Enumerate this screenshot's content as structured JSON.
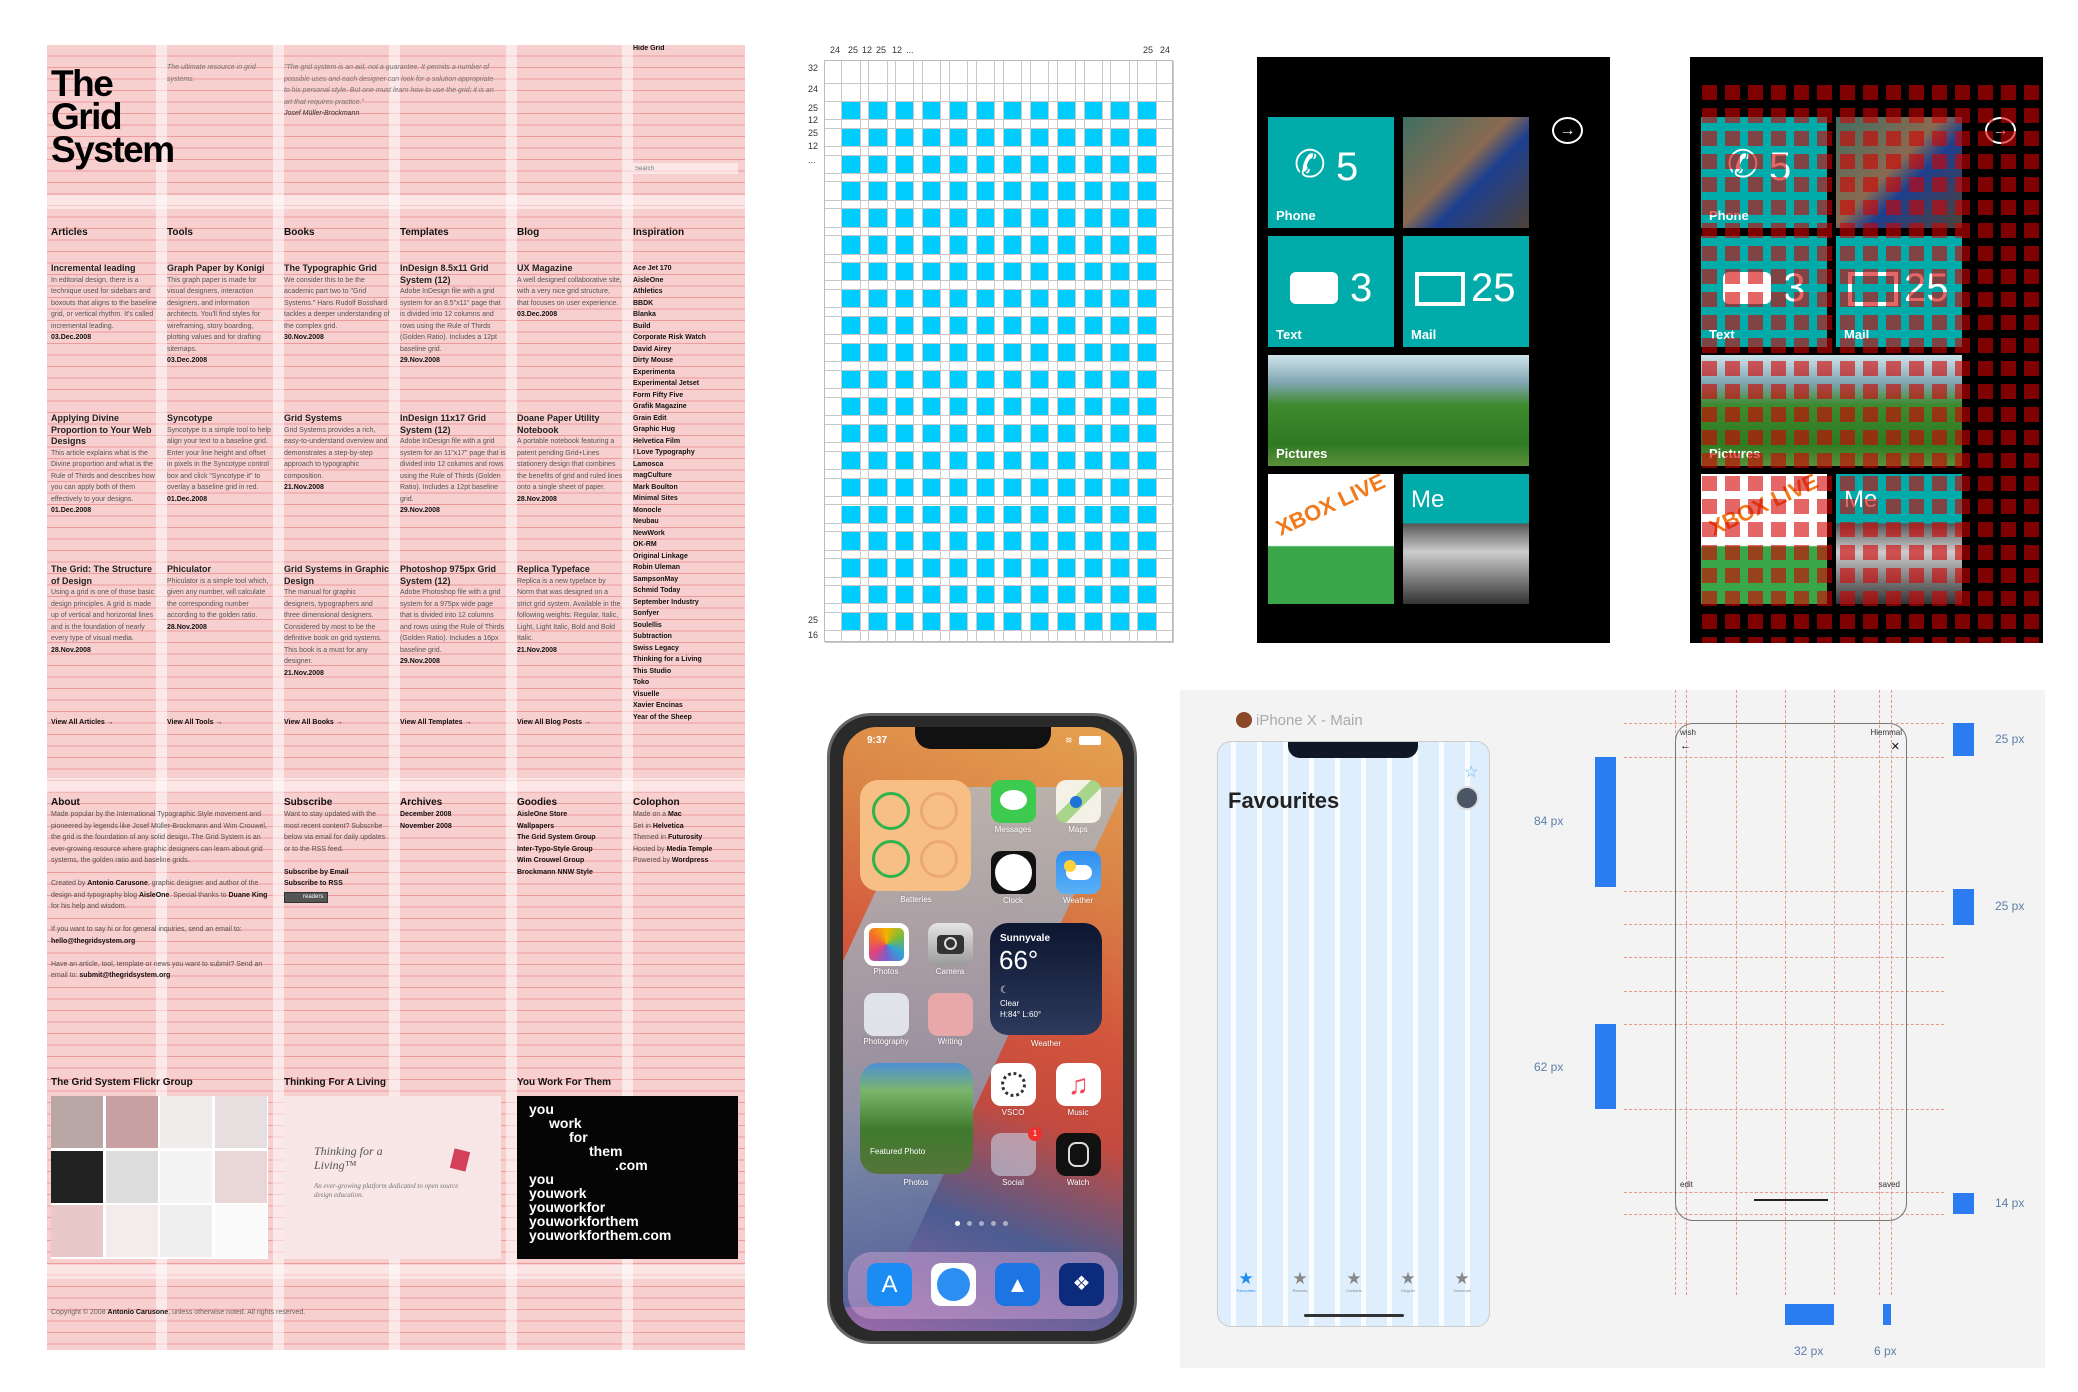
{
  "site": {
    "title_lines": [
      "The",
      "Grid",
      "System"
    ],
    "tagline": "The ultimate resource in grid systems.",
    "quote": "\"The grid system is an aid, not a guarantee. It permits a number of possible uses and each designer can look for a solution appropriate to his personal style. But one must learn how to use the grid; it is an art that requires practice.\"",
    "quote_author": "Josef Müller-Brockmann",
    "hide_grid": "Hide Grid",
    "search_placeholder": "Search",
    "columns": [
      {
        "heading": "Articles",
        "view_all": "View All Articles →",
        "items": [
          {
            "title": "Incremental leading",
            "body": "In editorial design, there is a technique used for sidebars and boxouts that aligns to the baseline grid, or vertical rhythm. It's called incremental leading.",
            "date": "03.Dec.2008"
          },
          {
            "title": "Applying Divine Proportion to Your Web Designs",
            "body": "This article explains what is the Divine proportion and what is the Rule of Thirds and describes how you can apply both of them effectively to your designs.",
            "date": "01.Dec.2008"
          },
          {
            "title": "The Grid: The Structure of Design",
            "body": "Using a grid is one of those basic design principles. A grid is made up of vertical and horizontal lines and is the foundation of nearly every type of visual media.",
            "date": "28.Nov.2008"
          }
        ]
      },
      {
        "heading": "Tools",
        "view_all": "View All Tools →",
        "items": [
          {
            "title": "Graph Paper by Konigi",
            "body": "This graph paper is made for visual designers, interaction designers, and information architects. You'll find styles for wireframing, story boarding, plotting values and for drafting sitemaps.",
            "date": "03.Dec.2008"
          },
          {
            "title": "Syncotype",
            "body": "Syncotype is a simple tool to help align your text to a baseline grid. Enter your line height and offset in pixels in the Syncotype control box and click \"Syncotype it\" to overlay a baseline grid in red.",
            "date": "01.Dec.2008"
          },
          {
            "title": "Phiculator",
            "body": "Phiculator is a simple tool which, given any number, will calculate the corresponding number according to the golden ratio.",
            "date": "28.Nov.2008"
          }
        ]
      },
      {
        "heading": "Books",
        "view_all": "View All Books →",
        "items": [
          {
            "title": "The Typographic Grid",
            "body": "We consider this to be the academic part two to \"Grid Systems.\" Hans Rudolf Bosshard tackles a deeper understanding of the complex grid.",
            "date": "30.Nov.2008"
          },
          {
            "title": "Grid Systems",
            "body": "Grid Systems provides a rich, easy-to-understand overview and demonstrates a step-by-step approach to typographic composition.",
            "date": "21.Nov.2008"
          },
          {
            "title": "Grid Systems in Graphic Design",
            "body": "The manual for graphic designers, typographers and three dimensional designers. Considered by most to be the definitive book on grid systems. This book is a must for any designer.",
            "date": "21.Nov.2008"
          }
        ]
      },
      {
        "heading": "Templates",
        "view_all": "View All Templates →",
        "items": [
          {
            "title": "InDesign 8.5x11 Grid System (12)",
            "body": "Adobe InDesign file with a grid system for an 8.5\"x11\" page that is divided into 12 columns and rows using the Rule of Thirds (Golden Ratio). Includes a 12pt baseline grid.",
            "date": "29.Nov.2008"
          },
          {
            "title": "InDesign 11x17 Grid System (12)",
            "body": "Adobe InDesign file with a grid system for an 11\"x17\" page that is divided into 12 columns and rows using the Rule of Thirds (Golden Ratio). Includes a 12pt baseline grid.",
            "date": "29.Nov.2008"
          },
          {
            "title": "Photoshop 975px Grid System (12)",
            "body": "Adobe Photoshop file with a grid system for a 975px wide page that is divided into 12 columns and rows using the Rule of Thirds (Golden Ratio). Includes a 16px baseline grid.",
            "date": "29.Nov.2008"
          }
        ]
      },
      {
        "heading": "Blog",
        "view_all": "View All Blog Posts →",
        "items": [
          {
            "title": "UX Magazine",
            "body": "A well designed collaborative site, with a very nice grid structure, that focuses on user experience.",
            "date": "03.Dec.2008"
          },
          {
            "title": "Doane Paper Utility Notebook",
            "body": "A portable notebook featuring a patent pending Grid+Lines stationery design that combines the benefits of grid and ruled lines onto a single sheet of paper.",
            "date": "28.Nov.2008"
          },
          {
            "title": "Replica Typeface",
            "body": "Replica is a new typeface by Norm that was designed on a strict grid system. Available in the following weights: Regular, Italic, Light, Light Italic, Bold and Bold Italic.",
            "date": "21.Nov.2008"
          }
        ]
      }
    ],
    "inspiration": {
      "heading": "Inspiration",
      "items": [
        "Ace Jet 170",
        "AisleOne",
        "Athletics",
        "BBDK",
        "Blanka",
        "Build",
        "Corporate Risk Watch",
        "David Airey",
        "Dirty Mouse",
        "Experimenta",
        "Experimental Jetset",
        "Form Fifty Five",
        "Grafik Magazine",
        "Grain Edit",
        "Graphic Hug",
        "Helvetica Film",
        "I Love Typography",
        "Lamosca",
        "magCulture",
        "Mark Boulton",
        "Minimal Sites",
        "Monocle",
        "Neubau",
        "NewWork",
        "OK-RM",
        "Original Linkage",
        "Robin Uleman",
        "SampsonMay",
        "Schmid Today",
        "September Industry",
        "Sonfyer",
        "Soulellis",
        "Subtraction",
        "Swiss Legacy",
        "Thinking for a Living",
        "This Studio",
        "Toko",
        "Visuelle",
        "Xavier Encinas",
        "Year of the Sheep"
      ]
    },
    "about": {
      "heading": "About",
      "p1": "Made popular by the International Typographic Style movement and pioneered by legends like Josef Müller-Brockmann and Wim Crouwel, the grid is the foundation of any solid design. The Grid System is an ever-growing resource where graphic designers can learn about grid systems, the golden ratio and baseline grids.",
      "p2_pre": "Created by ",
      "p2_name": "Antonio Carusone",
      "p2_mid": ", graphic designer and author of the design and typography blog ",
      "p2_blog": "AisleOne",
      "p2_post": ". Special thanks to ",
      "p2_thanks": "Duane King",
      "p2_end": " for his help and wisdom.",
      "p3_pre": "If you want to say hi or for general inquiries, send an email to: ",
      "p3_email": "hello@thegridsystem.org",
      "p4_pre": "Have an article, tool, template or news you want to submit? Send an email to: ",
      "p4_email": "submit@thegridsystem.org"
    },
    "subscribe": {
      "heading": "Subscribe",
      "body": "Want to stay updated with the most recent content? Subscribe below via email for daily updates or to the RSS feed.",
      "email": "Subscribe by Email",
      "rss": "Subscribe to RSS",
      "badge": "readers"
    },
    "archives": {
      "heading": "Archives",
      "items": [
        "December 2008",
        "November 2008"
      ]
    },
    "goodies": {
      "heading": "Goodies",
      "items": [
        "AisleOne Store",
        "Wallpapers",
        "The Grid System Group",
        "Inter-Typo-Style Group",
        "Wim Crouwel Group",
        "Brockmann NNW Style"
      ]
    },
    "colophon": {
      "heading": "Colophon",
      "items": [
        {
          "pre": "Made on a ",
          "link": "Mac"
        },
        {
          "pre": "Set in ",
          "link": "Helvetica"
        },
        {
          "pre": "Themed in ",
          "link": "Futurosity"
        },
        {
          "pre": "Hosted by ",
          "link": "Media Temple"
        },
        {
          "pre": "Powered by ",
          "link": "Wordpress"
        }
      ]
    },
    "flickr_heading": "The Grid System Flickr Group",
    "tfal_heading": "Thinking For A Living",
    "tfal_logo": "Thinking for a Living™",
    "tfal_desc": "An ever-growing platform dedicated to open source design education.",
    "ywft_heading": "You Work For Them",
    "ywft_lines": [
      "you",
      "work",
      "for",
      "them",
      ".com",
      "you",
      "youwork",
      "youworkfor",
      "youworkforthem",
      "youworkforthem.com"
    ],
    "copyright_pre": "Copyright © 2008 ",
    "copyright_name": "Antonio Carusone",
    "copyright_post": ", unless otherwise noted. All rights reserved.",
    "colors": {
      "overlay": "#f7cfcf",
      "grid_line": "#e46e6e"
    }
  },
  "grid_spec": {
    "top_labels": [
      "24",
      "25",
      "12",
      "25",
      "12",
      "...",
      "25",
      "24"
    ],
    "left_labels": [
      "32",
      "24",
      "25",
      "12",
      "25",
      "12",
      "...",
      "25",
      "16"
    ],
    "fill_color": "#00ccff"
  },
  "windows_phone": {
    "tiles": {
      "phone_label": "Phone",
      "phone_count": "5",
      "text_label": "Text",
      "text_count": "3",
      "mail_label": "Mail",
      "mail_count": "25",
      "pictures_label": "Pictures",
      "xbox_label": "XBOX LIVE",
      "me_label": "Me"
    },
    "accent": "#00aba9",
    "overlay_color": "#d40000"
  },
  "iphone": {
    "time": "9:37",
    "apps": {
      "batteries": "Batteries",
      "messages": "Messages",
      "maps": "Maps",
      "clock": "Clock",
      "weather": "Weather",
      "photos": "Photos",
      "camera": "Camera",
      "photography": "Photography",
      "writing": "Writing",
      "weather_widget": "Weather",
      "featured_photos": "Photos",
      "vsco": "VSCO",
      "music": "Music",
      "social": "Social",
      "watch": "Watch"
    },
    "weather": {
      "city": "Sunnyvale",
      "temp": "66°",
      "condition": "Clear",
      "hilo": "H:84° L:60°"
    },
    "featured_photo_label": "Featured Photo",
    "social_badge": "1",
    "page_count": 5,
    "page_active": 1
  },
  "sketch": {
    "artboard_name": "iPhone X - Main",
    "mock_title": "Favourites",
    "tab_labels": [
      "Favourites",
      "Recents",
      "Contacts",
      "Keypad",
      "Voicemail"
    ],
    "wireframe": {
      "top_left": "wish",
      "top_right": "Hiemmal",
      "bottom_left": "edit",
      "bottom_right": "saved"
    },
    "measurements": {
      "left_top": "84 px",
      "left_bottom": "62 px",
      "right_top": "25 px",
      "right_middle": "25 px",
      "right_bottom": "14 px",
      "bottom_left": "32 px",
      "bottom_right": "6 px"
    },
    "accent": "#2b7cf1"
  }
}
